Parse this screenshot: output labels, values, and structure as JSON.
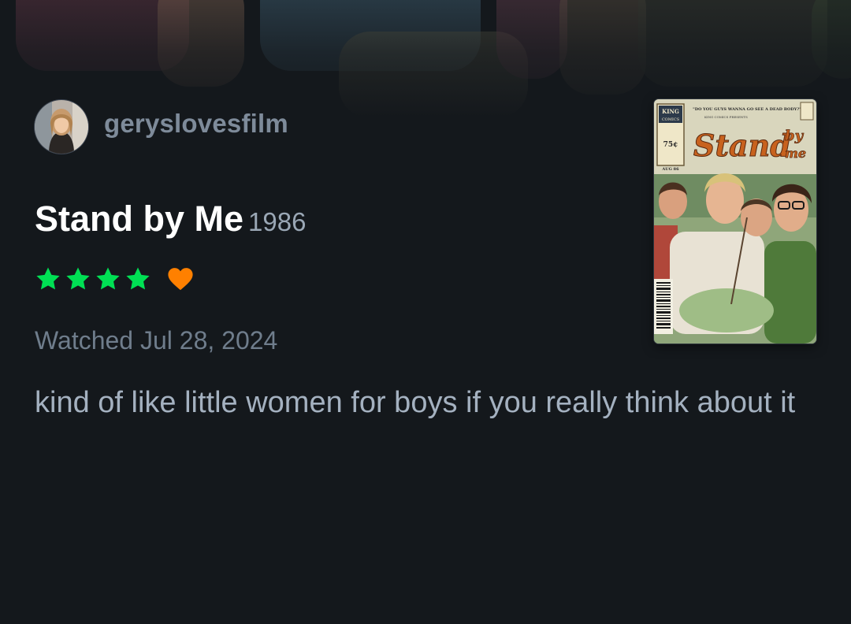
{
  "review": {
    "username": "geryslovesfilm",
    "film_title": "Stand by Me",
    "film_year": "1986",
    "rating_stars": 4,
    "liked": true,
    "watched_text": "Watched Jul 28, 2024",
    "body": "kind of like little women for boys if you really think about it"
  },
  "poster": {
    "publisher": "KING",
    "publisher_sub": "COMICS",
    "price": "75¢",
    "month": "AUG 86",
    "tagline": "\"DO YOU GUYS WANNA GO SEE A DEAD BODY?\"",
    "presents": "KING COMICS PRESENTS",
    "title_main": "Stand",
    "title_by": "by",
    "title_me": "me"
  },
  "colors": {
    "background": "#14181c",
    "star_green": "#00e054",
    "heart_orange": "#ff8000",
    "username": "#7e8b9a",
    "year": "#9aa7b5",
    "watched": "#6f7d8c",
    "body_text": "#a4b1c0"
  },
  "icons": {
    "star": "star-icon",
    "heart": "heart-icon"
  }
}
